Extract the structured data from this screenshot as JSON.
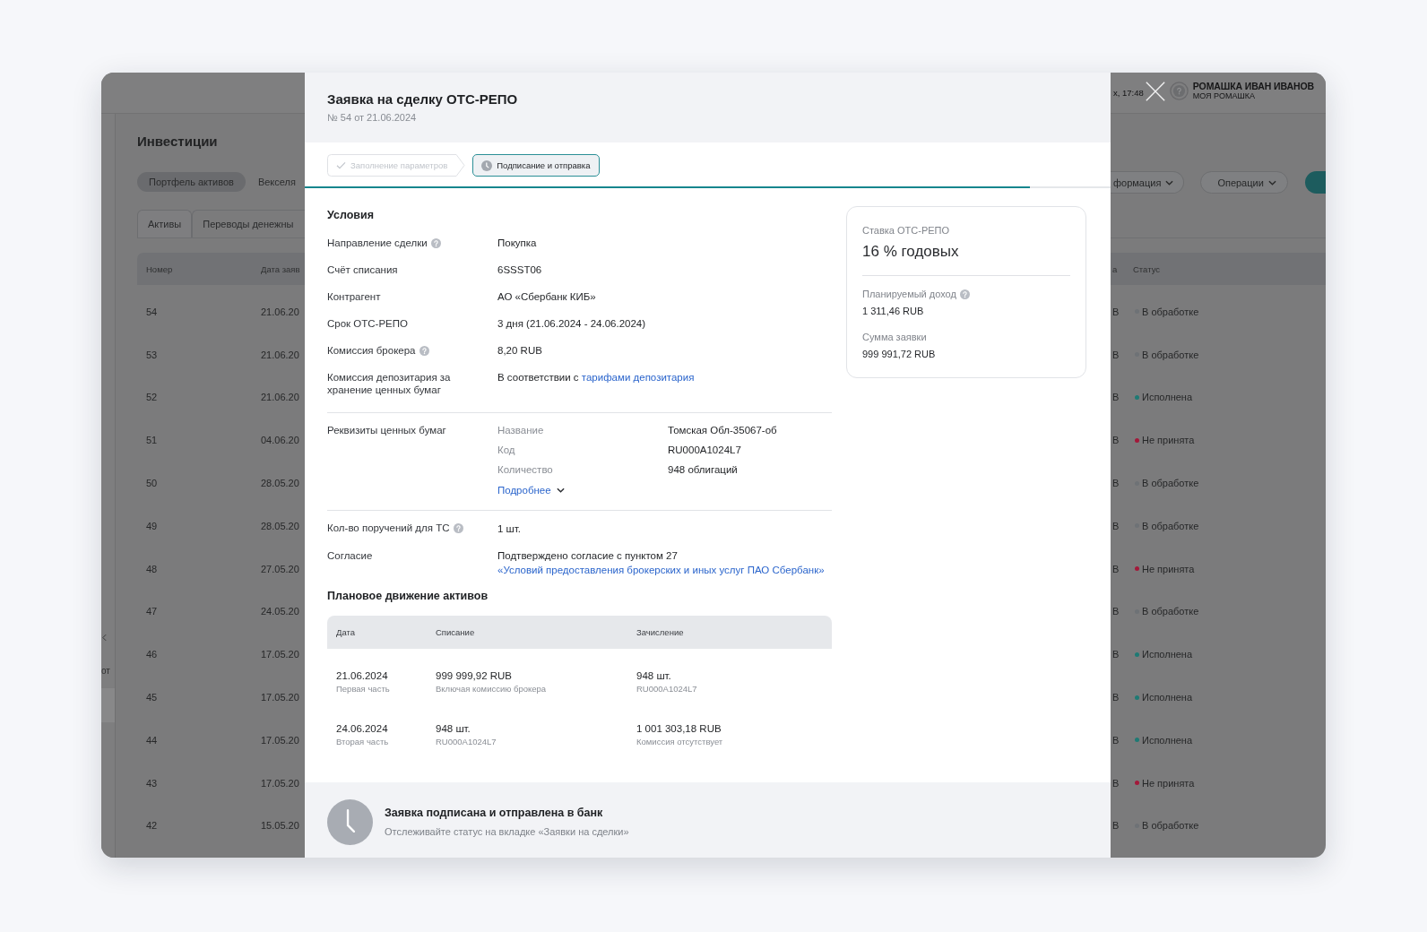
{
  "background_app": {
    "header": {
      "time": "х, 17:48",
      "user_name": "РОМАШКА ИВАН ИВАНОВ",
      "user_org": "МОЯ РОМАШКА"
    },
    "sidebar": {
      "fragment": "от"
    },
    "page_title": "Инвестиции",
    "pills": [
      {
        "label": "Портфель активов",
        "selected": true
      },
      {
        "label": "Векселя",
        "selected": false
      }
    ],
    "tabs": [
      {
        "label": "Активы",
        "selected": true
      },
      {
        "label": "Переводы денежны",
        "selected": false
      }
    ],
    "menu_buttons": [
      {
        "label": "формация"
      },
      {
        "label": "Операции"
      }
    ],
    "table": {
      "columns": [
        "Номер",
        "Дата заяв",
        "а",
        "Статус"
      ],
      "rows": [
        {
          "number": "54",
          "date": "21.06.20",
          "amount": "B",
          "status": "В обработке",
          "color": "#6e7276"
        },
        {
          "number": "53",
          "date": "21.06.20",
          "amount": "B",
          "status": "В обработке",
          "color": "#6e7276"
        },
        {
          "number": "52",
          "date": "21.06.20",
          "amount": "B",
          "status": "Исполнена",
          "color": "#1f7a74"
        },
        {
          "number": "51",
          "date": "04.06.20",
          "amount": "B",
          "status": "Не принята",
          "color": "#a3193a"
        },
        {
          "number": "50",
          "date": "28.05.20",
          "amount": "B",
          "status": "В обработке",
          "color": "#6e7276"
        },
        {
          "number": "49",
          "date": "28.05.20",
          "amount": "B",
          "status": "В обработке",
          "color": "#6e7276"
        },
        {
          "number": "48",
          "date": "27.05.20",
          "amount": "B",
          "status": "Не принята",
          "color": "#a3193a"
        },
        {
          "number": "47",
          "date": "24.05.20",
          "amount": "B",
          "status": "В обработке",
          "color": "#6e7276"
        },
        {
          "number": "46",
          "date": "17.05.20",
          "amount": "B",
          "status": "Исполнена",
          "color": "#1f7a74"
        },
        {
          "number": "45",
          "date": "17.05.20",
          "amount": "B",
          "status": "Исполнена",
          "color": "#1f7a74"
        },
        {
          "number": "44",
          "date": "17.05.20",
          "amount": "B",
          "status": "Исполнена",
          "color": "#1f7a74"
        },
        {
          "number": "43",
          "date": "17.05.20",
          "amount": "B",
          "status": "Не принята",
          "color": "#a3193a"
        },
        {
          "number": "42",
          "date": "15.05.20",
          "amount": "B",
          "status": "В обработке",
          "color": "#6e7276"
        }
      ]
    }
  },
  "modal": {
    "title": "Заявка на сделку ОТС-РЕПО",
    "subtitle": "№ 54 от 21.06.2024",
    "steps": [
      {
        "label": "Заполнение параметров",
        "kind": "done",
        "selected": false
      },
      {
        "label": "Подписание и отправка",
        "kind": "pending",
        "selected": true
      }
    ],
    "progress": {
      "level": 0.9
    },
    "conditions": {
      "title": "Условия",
      "rows": [
        {
          "label": "Направление сделки",
          "help": true,
          "value": "Покупка"
        },
        {
          "label": "Счёт списания",
          "help": false,
          "value": "6SSST06"
        },
        {
          "label": "Контрагент",
          "help": false,
          "value": "АО «Сбербанк КИБ»"
        },
        {
          "label": "Срок ОТС-РЕПО",
          "help": false,
          "value": "3 дня (21.06.2024 - 24.06.2024)"
        },
        {
          "label": "Комиссия брокера",
          "help": true,
          "value": "8,20 RUB"
        },
        {
          "label": "Комиссия депозитария за хранение ценных бумаг",
          "help": false,
          "value": "В соответствии с",
          "link": "тарифами депозитария"
        }
      ]
    },
    "securities": {
      "label": "Реквизиты ценных бумаг",
      "fields": [
        {
          "name": "Название",
          "value": "Томская Обл-35067-об"
        },
        {
          "name": "Код",
          "value": "RU000A1024L7"
        },
        {
          "name": "Количество",
          "value": "948 облигаций"
        }
      ],
      "more": "Подробнее"
    },
    "extra_rows": [
      {
        "label": "Кол-во поручений для ТС",
        "help": true,
        "value": "1 шт."
      },
      {
        "label": "Согласие",
        "help": false,
        "value": "Подтверждено согласие с пунктом 27",
        "link": "«Условий предоставления брокерских и иных услуг ПАО Сбербанк»"
      }
    ],
    "movement": {
      "title": "Плановое движение активов",
      "columns": [
        "Дата",
        "Списание",
        "Зачисление"
      ],
      "rows": [
        {
          "cells": [
            {
              "main": "21.06.2024",
              "note": "Первая часть"
            },
            {
              "main": "999 999,92 RUB",
              "note": "Включая комиссию брокера"
            },
            {
              "main": "948 шт.",
              "note": "RU000A1024L7"
            }
          ]
        },
        {
          "cells": [
            {
              "main": "24.06.2024",
              "note": "Вторая часть"
            },
            {
              "main": "948 шт.",
              "note": "RU000A1024L7"
            },
            {
              "main": "1 001 303,18 RUB",
              "note": "Комиссия отсутствует"
            }
          ]
        }
      ]
    },
    "summary": {
      "rate_label": "Ставка ОТС-РЕПО",
      "rate": "16 % годовых",
      "items": [
        {
          "label": "Планируемый доход",
          "help": true,
          "value": "1 311,46 RUB"
        },
        {
          "label": "Сумма заявки",
          "help": false,
          "value": "999 991,72 RUB"
        }
      ]
    },
    "status_banner": {
      "title": "Заявка подписана и отправлена в банк",
      "text": "Отслеживайте статус на вкладке «Заявки на сделки»"
    }
  }
}
